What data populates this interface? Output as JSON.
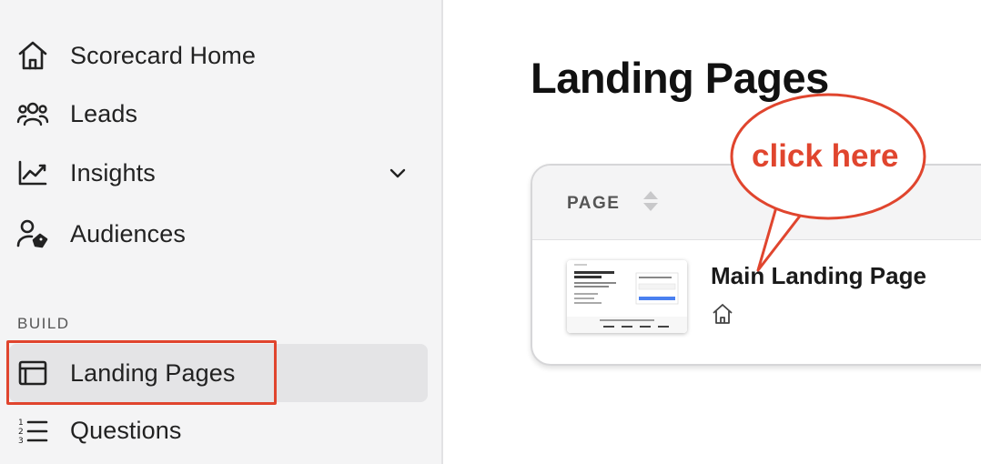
{
  "sidebar": {
    "items": [
      {
        "label": "Scorecard Home",
        "icon": "home-icon"
      },
      {
        "label": "Leads",
        "icon": "users-icon"
      },
      {
        "label": "Insights",
        "icon": "chart-line-icon"
      },
      {
        "label": "Audiences",
        "icon": "user-tag-icon"
      }
    ],
    "section_label": "BUILD",
    "build_items": [
      {
        "label": "Landing Pages",
        "icon": "browser-window-icon",
        "active": true
      },
      {
        "label": "Questions",
        "icon": "numbered-list-icon"
      }
    ]
  },
  "main": {
    "title": "Landing Pages",
    "table": {
      "column_header": "PAGE",
      "rows": [
        {
          "title": "Main Landing Page",
          "icon": "home-icon"
        }
      ]
    }
  },
  "annotation": {
    "callout_text": "click here",
    "color": "#e0452e"
  }
}
